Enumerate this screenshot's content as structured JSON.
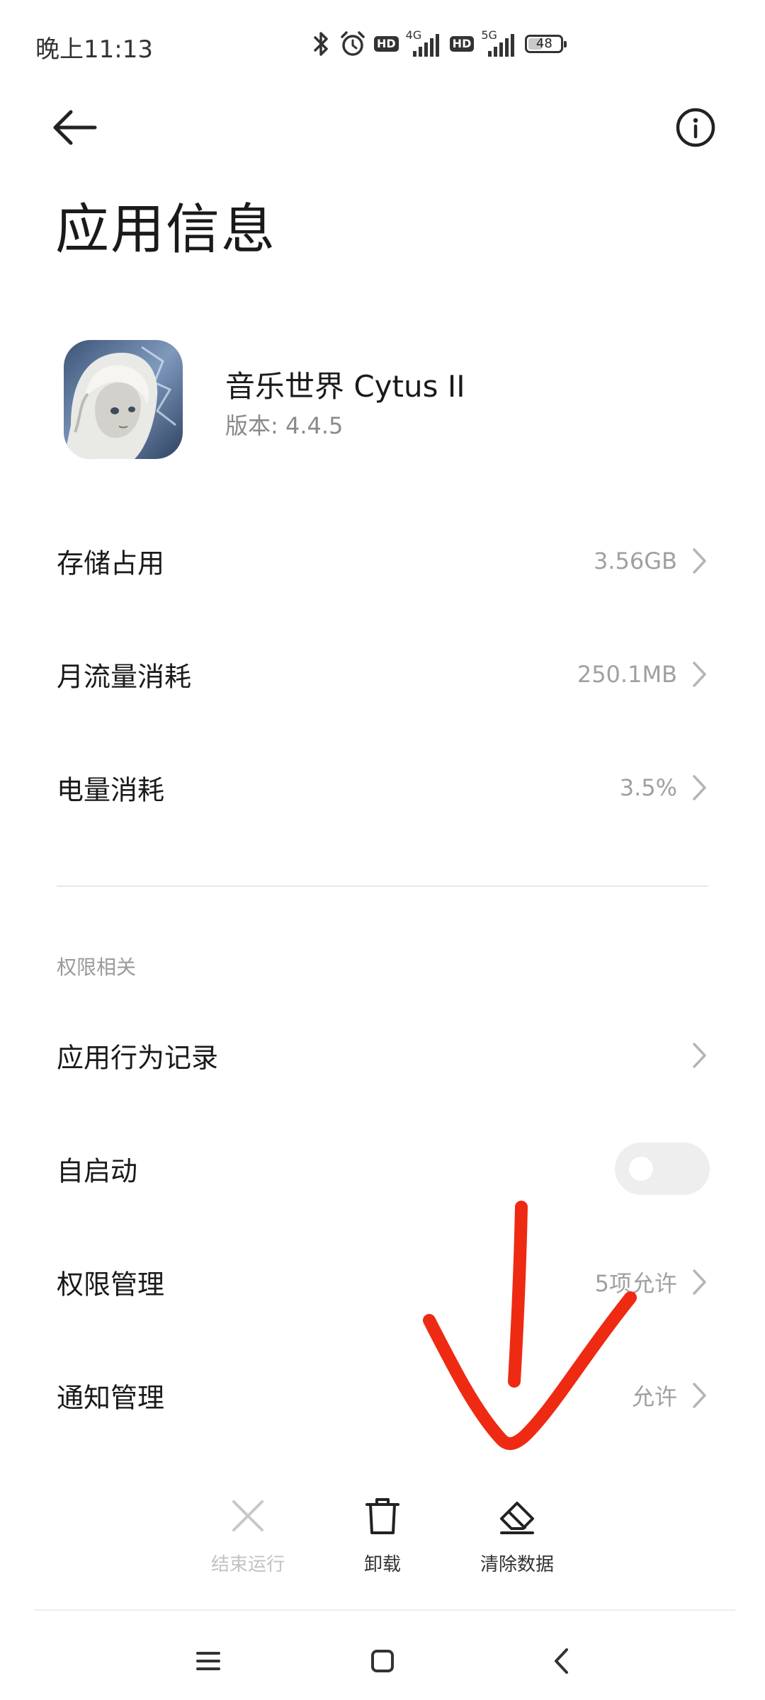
{
  "status_bar": {
    "time": "晚上11:13",
    "net1_label": "4G",
    "net2_label": "5G",
    "hd_label": "HD",
    "battery": "48",
    "battery_level": 0.48
  },
  "header": {
    "title": "应用信息",
    "back_icon": "back-arrow-icon",
    "info_icon": "info-icon"
  },
  "app": {
    "name": "音乐世界 Cytus II",
    "version": "版本: 4.4.5"
  },
  "usage_rows": [
    {
      "label": "存储占用",
      "value": "3.56GB"
    },
    {
      "label": "月流量消耗",
      "value": "250.1MB"
    },
    {
      "label": "电量消耗",
      "value": "3.5%"
    }
  ],
  "permissions": {
    "section_title": "权限相关",
    "behavior_log": {
      "label": "应用行为记录"
    },
    "autostart": {
      "label": "自启动",
      "enabled": false
    },
    "permission_mgmt": {
      "label": "权限管理",
      "value": "5项允许"
    },
    "notification_mgmt": {
      "label": "通知管理",
      "value": "允许"
    }
  },
  "actions": {
    "force_stop": "结束运行",
    "uninstall": "卸载",
    "clear_data": "清除数据"
  },
  "colors": {
    "annotation": "#ee2a12",
    "chevron": "#b5b5b5",
    "muted_text": "#a0a0a0"
  }
}
